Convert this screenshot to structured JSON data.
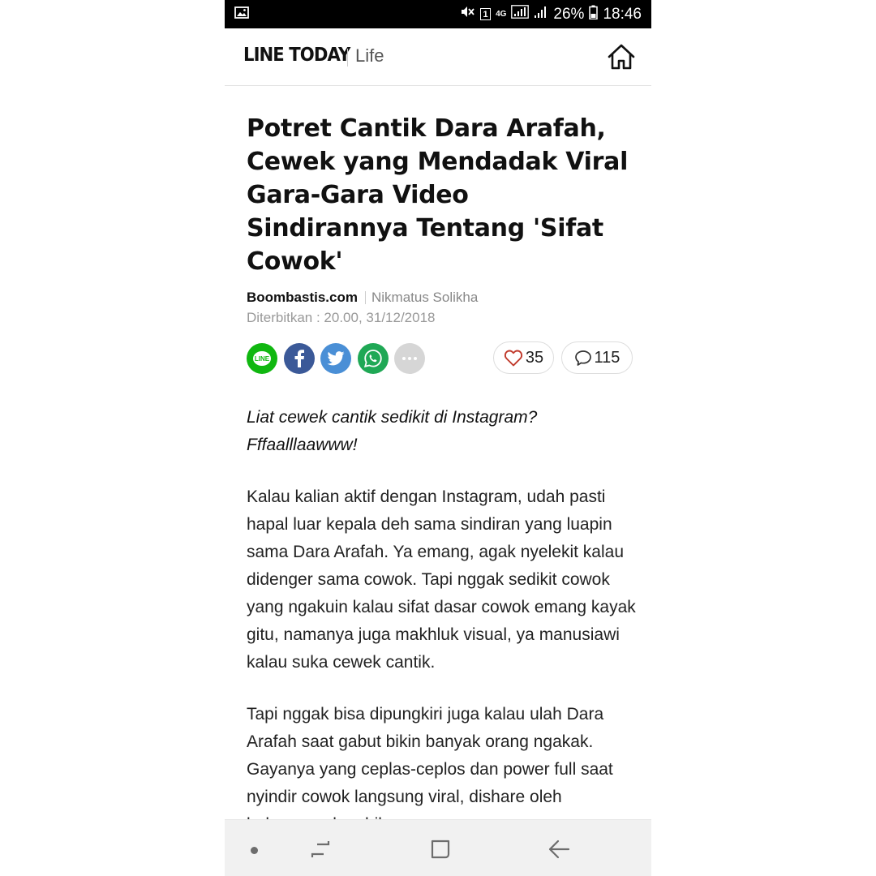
{
  "status_bar": {
    "signal_label": "4G",
    "sim_label": "1",
    "battery": "26%",
    "time": "18:46"
  },
  "header": {
    "brand": "LINE TODAY",
    "section": "Life",
    "home_icon": "home-icon"
  },
  "article": {
    "title": "Potret Cantik Dara Arafah, Cewek yang Mendadak Viral Gara-Gara Video Sindirannya Tentang 'Sifat Cowok'",
    "source": "Boombastis.com",
    "author": "Nikmatus Solikha",
    "published": "Diterbitkan : 20.00, 31/12/2018",
    "share_buttons": [
      {
        "name": "LINE",
        "icon": "line-icon",
        "color": "#10b710",
        "label": "LINE"
      },
      {
        "name": "Facebook",
        "icon": "facebook-icon",
        "color": "#3b5998"
      },
      {
        "name": "Twitter",
        "icon": "twitter-icon",
        "color": "#4a8fd6"
      },
      {
        "name": "WhatsApp",
        "icon": "whatsapp-icon",
        "color": "#1fa855"
      },
      {
        "name": "More",
        "icon": "more-icon",
        "color": "#d6d6d6"
      }
    ],
    "likes": "35",
    "comments": "115",
    "lead": "Liat cewek cantik sedikit di Instagram? Fffaalllaawww!",
    "paragraphs": [
      "Kalau kalian aktif dengan Instagram, udah pasti hapal luar kepala deh sama sindiran yang luapin sama Dara Arafah. Ya emang, agak nyelekit kalau didenger sama cowok. Tapi nggak sedikit cowok yang ngakuin kalau sifat dasar cowok emang kayak gitu, namanya juga makhluk visual, ya manusiawi kalau suka cewek cantik.",
      "Tapi nggak bisa dipungkiri juga kalau ulah Dara Arafah saat gabut bikin banyak orang ngakak. Gayanya yang ceplas-ceplos dan power full saat nyindir cowok langsung viral, dishare oleh beberapa akun hiburan."
    ]
  },
  "nav_bar": {
    "buttons": [
      "recent-apps-icon",
      "home-button-icon",
      "back-icon"
    ]
  }
}
